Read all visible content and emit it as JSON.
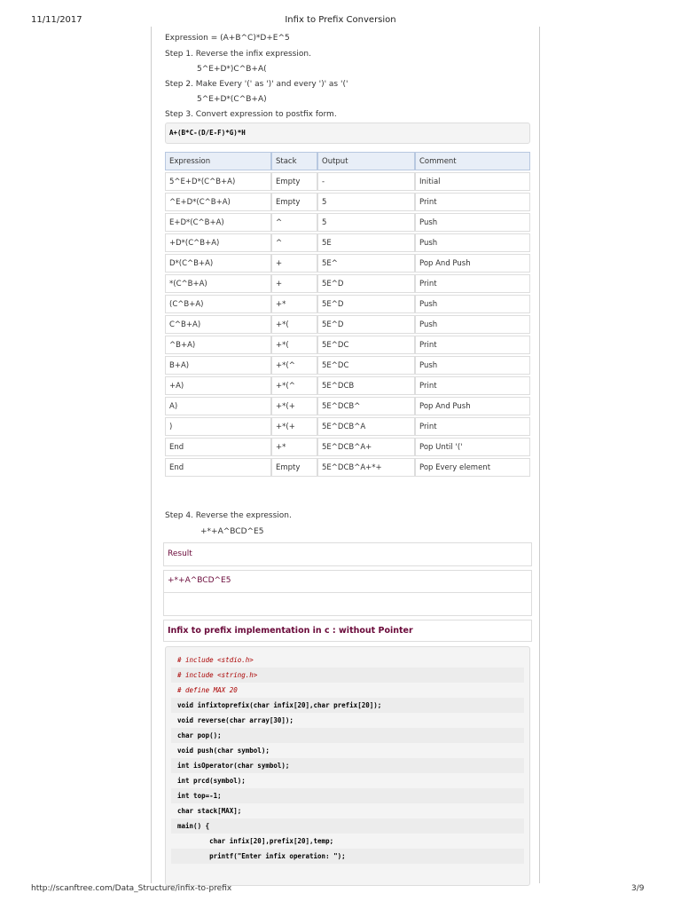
{
  "header": {
    "date": "11/11/2017",
    "title": "Infix to Prefix Conversion"
  },
  "footer": {
    "url": "http://scanftree.com/Data_Structure/infix-to-prefix",
    "page": "3/9"
  },
  "intro": {
    "expression": "Expression = (A+B^C)*D+E^5",
    "step1": "Step 1. Reverse the infix expression.",
    "step1_value": "5^E+D*)C^B+A(",
    "step2": "Step 2. Make Every '(' as ')' and every ')' as '('",
    "step2_value": "5^E+D*(C^B+A)",
    "step3": "Step 3. Convert expression to postfix form.",
    "step3_code": "A+(B*C-(D/E-F)*G)*H"
  },
  "table": {
    "headers": [
      "Expression",
      "Stack",
      "Output",
      "Comment"
    ],
    "rows": [
      [
        "5^E+D*(C^B+A)",
        "Empty",
        "-",
        "Initial"
      ],
      [
        "^E+D*(C^B+A)",
        "Empty",
        "5",
        "Print"
      ],
      [
        "E+D*(C^B+A)",
        "^",
        "5",
        "Push"
      ],
      [
        "+D*(C^B+A)",
        "^",
        "5E",
        "Push"
      ],
      [
        "D*(C^B+A)",
        "+",
        "5E^",
        "Pop And Push"
      ],
      [
        "*(C^B+A)",
        "+",
        "5E^D",
        "Print"
      ],
      [
        "(C^B+A)",
        "+*",
        "5E^D",
        "Push"
      ],
      [
        "C^B+A)",
        "+*(",
        "5E^D",
        "Push"
      ],
      [
        "^B+A)",
        "+*(",
        "5E^DC",
        "Print"
      ],
      [
        "B+A)",
        "+*(^",
        "5E^DC",
        "Push"
      ],
      [
        "+A)",
        "+*(^",
        "5E^DCB",
        "Print"
      ],
      [
        "A)",
        "+*(+",
        "5E^DCB^",
        "Pop And Push"
      ],
      [
        ")",
        "+*(+",
        "5E^DCB^A",
        "Print"
      ],
      [
        "End",
        "+*",
        "5E^DCB^A+",
        "Pop Until '('"
      ],
      [
        "End",
        "Empty",
        "5E^DCB^A+*+",
        "Pop Every element"
      ]
    ]
  },
  "step4": {
    "label": "Step 4. Reverse the expression.",
    "value": "+*+A^BCD^E5"
  },
  "result": {
    "label": "Result",
    "value": "+*+A^BCD^E5"
  },
  "impl_heading": "Infix to prefix implementation in c : without Pointer",
  "code_lines": [
    "# include <stdio.h>",
    "# include <string.h>",
    "# define MAX 20",
    "void infixtoprefix(char infix[20],char prefix[20]);",
    "void reverse(char array[30]);",
    "char pop();",
    "void push(char symbol);",
    "int isOperator(char symbol);",
    "int prcd(symbol);",
    "int top=-1;",
    "char stack[MAX];",
    "main() {",
    "        char infix[20],prefix[20],temp;",
    "        printf(\"Enter infix operation: \");"
  ]
}
